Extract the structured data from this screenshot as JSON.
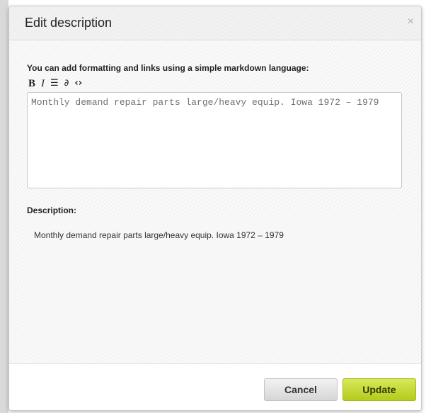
{
  "dialog": {
    "title": "Edit description",
    "close_glyph": "×",
    "instruction": "You can add formatting and links using a simple markdown language:",
    "toolbar": [
      {
        "name": "bold-tool",
        "icon": "bold-icon",
        "glyph": "B"
      },
      {
        "name": "italic-tool",
        "icon": "italic-icon",
        "glyph": "I"
      },
      {
        "name": "list-tool",
        "icon": "list-icon",
        "glyph": "☰"
      },
      {
        "name": "link-tool",
        "icon": "link-icon",
        "glyph": "∂"
      },
      {
        "name": "code-tool",
        "icon": "code-icon",
        "glyph": "‹›"
      }
    ],
    "editor_value": "Monthly demand repair parts large/heavy equip. Iowa 1972 – 1979",
    "description_label": "Description:",
    "preview_text": "Monthly demand repair parts large/heavy equip. Iowa 1972 – 1979",
    "buttons": {
      "cancel": "Cancel",
      "update": "Update"
    }
  },
  "colors": {
    "update_button": "#c4d72a",
    "cancel_button": "#e0e0e0",
    "header_bg": "#f0f0f0"
  }
}
